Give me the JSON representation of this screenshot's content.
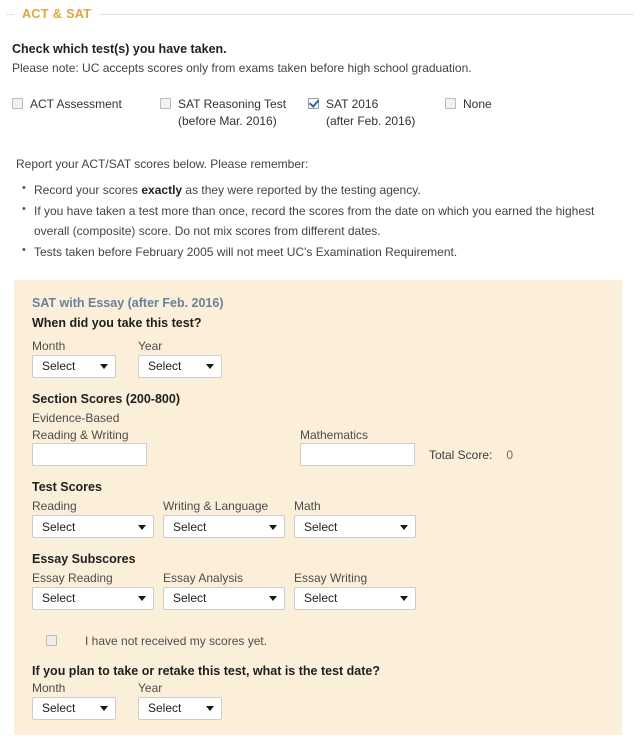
{
  "section": {
    "title": "ACT & SAT"
  },
  "intro": {
    "heading": "Check which test(s) you have taken.",
    "note": "Please note: UC accepts scores only from exams taken before high school graduation."
  },
  "test_checkboxes": [
    {
      "label": "ACT Assessment",
      "sublabel": "",
      "checked": false
    },
    {
      "label": "SAT Reasoning Test",
      "sublabel": "(before Mar. 2016)",
      "checked": false
    },
    {
      "label": "SAT 2016",
      "sublabel": "(after Feb. 2016)",
      "checked": true
    },
    {
      "label": "None",
      "sublabel": "",
      "checked": false
    }
  ],
  "report": {
    "lead": "Report your ACT/SAT scores below. Please remember:",
    "bullets": [
      {
        "pre": "Record your scores ",
        "bold": "exactly",
        "post": " as they were reported by the testing agency."
      },
      {
        "pre": "If you have taken a test more than once, record the scores from the date on which you earned the highest overall (composite) score. Do not mix scores from different dates.",
        "bold": "",
        "post": ""
      },
      {
        "pre": "Tests taken before February 2005 will not meet UC's Examination Requirement.",
        "bold": "",
        "post": ""
      }
    ]
  },
  "panel": {
    "title": "SAT with Essay (after Feb. 2016)",
    "when_question": "When did you take this test?",
    "month_label": "Month",
    "year_label": "Year",
    "month_value": "Select",
    "year_value": "Select",
    "section_scores_heading": "Section Scores (200-800)",
    "erw_label_line1": "Evidence-Based",
    "erw_label_line2": "Reading & Writing",
    "erw_value": "",
    "math_label": "Mathematics",
    "math_value": "",
    "total_label": "Total Score:",
    "total_value": "0",
    "test_scores_heading": "Test Scores",
    "test_scores": [
      {
        "label": "Reading",
        "value": "Select"
      },
      {
        "label": "Writing & Language",
        "value": "Select"
      },
      {
        "label": "Math",
        "value": "Select"
      }
    ],
    "essay_subscores_heading": "Essay Subscores",
    "essay_subscores": [
      {
        "label": "Essay Reading",
        "value": "Select"
      },
      {
        "label": "Essay Analysis",
        "value": "Select"
      },
      {
        "label": "Essay Writing",
        "value": "Select"
      }
    ],
    "not_received_label": "I have not received my scores yet.",
    "not_received_checked": false,
    "retake_question": "If you plan to take or retake this test, what is the test date?",
    "retake_month_label": "Month",
    "retake_year_label": "Year",
    "retake_month_value": "Select",
    "retake_year_value": "Select"
  },
  "colors": {
    "section_title": "#e8a33d",
    "panel_bg": "#fcefd9",
    "panel_title": "#6b7f9e",
    "checkmark": "#2a63b5"
  }
}
